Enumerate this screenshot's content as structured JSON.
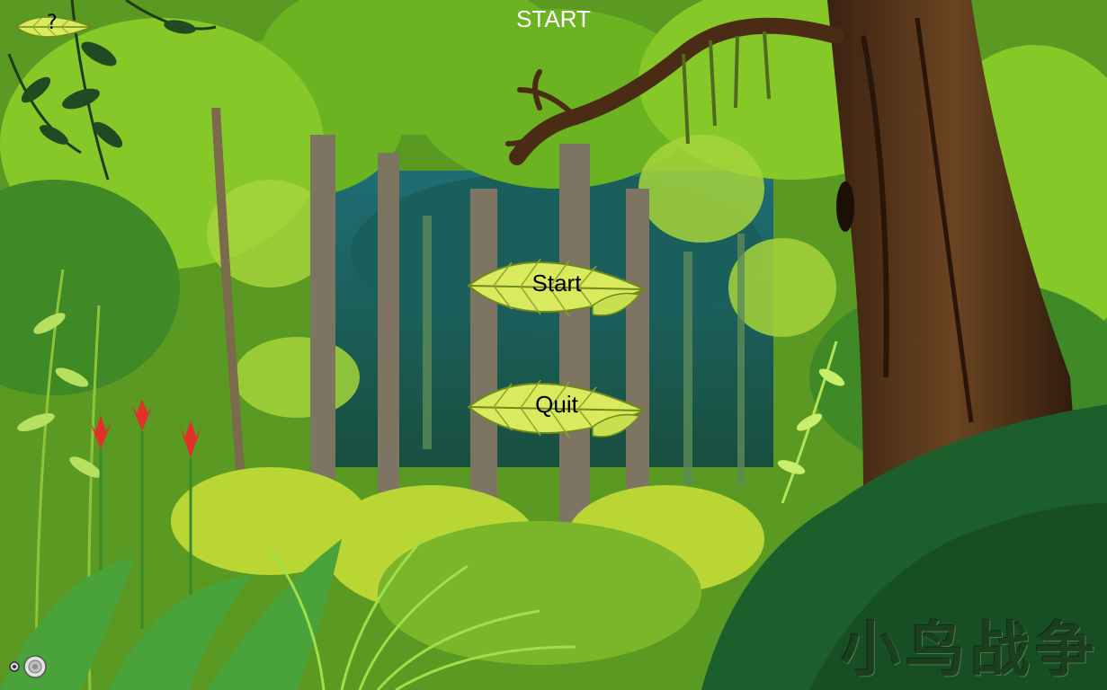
{
  "header": {
    "title": "START"
  },
  "help_button": {
    "label": "?",
    "icon": "leaf-icon"
  },
  "menu": {
    "start_label": "Start",
    "quit_label": "Quit"
  },
  "sound": {
    "icon": "speaker-icon"
  },
  "logo": {
    "text": "小鸟战争"
  },
  "colors": {
    "leaf": "#d9ea5e",
    "leaf_vein": "#6d8a1a",
    "forest_dark": "#1d5e2d",
    "canopy": "#5fa81e",
    "title_text": "#ffffff"
  }
}
